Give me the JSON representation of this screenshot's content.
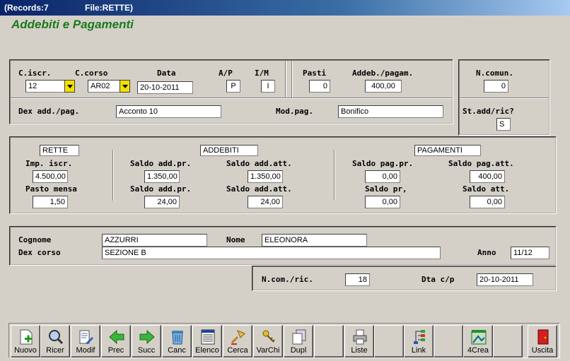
{
  "titlebar": {
    "records": "(Records:7",
    "file": "File:RETTE)"
  },
  "form_title": "Addebiti e Pagamenti",
  "top": {
    "labels": {
      "c_iscr": "C.iscr.",
      "c_corso": "C.corso",
      "data": "Data",
      "ap": "A/P",
      "im": "I/M",
      "pasti": "Pasti",
      "addeb": "Addeb./pagam.",
      "n_comun": "N.comun.",
      "dex": "Dex add./pag.",
      "mod_pag": "Mod.pag.",
      "st_add": "St.add/ric?"
    },
    "values": {
      "c_iscr": "12",
      "c_corso": "AR02",
      "data": "20-10-2011",
      "ap": "P",
      "im": "I",
      "pasti": "0",
      "addeb": "400,00",
      "n_comun": "0",
      "dex": "Acconto 10",
      "mod_pag": "Bonifico",
      "st_add": "S"
    }
  },
  "middle": {
    "rette": {
      "header": "RETTE",
      "imp_label": "Imp. iscr.",
      "imp_value": "4.500,00",
      "pasto_label": "Pasto mensa",
      "pasto_value": "1,50"
    },
    "addebiti": {
      "header": "ADDEBITI",
      "l1": "Saldo add.pr.",
      "v1": "1.350,00",
      "l2": "Saldo add.att.",
      "v2": "1.350,00",
      "l3": "Saldo add.pr.",
      "v3": "24,00",
      "l4": "Saldo add.att.",
      "v4": "24,00"
    },
    "pagamenti": {
      "header": "PAGAMENTI",
      "l1": "Saldo pag.pr.",
      "v1": "0,00",
      "l2": "Saldo pag.att.",
      "v2": "400,00",
      "l3": "Saldo pr,",
      "v3": "0,00",
      "l4": "Saldo att.",
      "v4": "0,00"
    }
  },
  "student": {
    "cognome_label": "Cognome",
    "cognome": "AZZURRI",
    "nome_label": "Nome",
    "nome": "ELEONORA",
    "dex_label": "Dex corso",
    "dex": "SEZIONE B",
    "anno_label": "Anno",
    "anno": "11/12"
  },
  "bottom": {
    "ncom_label": "N.com./ric.",
    "ncom": "18",
    "dta_label": "Dta c/p",
    "dta": "20-10-2011"
  },
  "toolbar": [
    {
      "label": "Nuovo",
      "icon": "new-doc-icon"
    },
    {
      "label": "Ricer",
      "icon": "magnifier-icon"
    },
    {
      "label": "Modif",
      "icon": "edit-doc-icon"
    },
    {
      "label": "Prec",
      "icon": "arrow-left-icon"
    },
    {
      "label": "Succ",
      "icon": "arrow-right-icon"
    },
    {
      "label": "Canc",
      "icon": "trash-icon"
    },
    {
      "label": "Elenco",
      "icon": "list-icon"
    },
    {
      "label": "Cerca",
      "icon": "search-icon"
    },
    {
      "label": "VarChi",
      "icon": "keys-icon"
    },
    {
      "label": "Dupl",
      "icon": "duplicate-icon"
    },
    {
      "label": "Liste",
      "icon": "printer-icon"
    },
    {
      "label": "Link",
      "icon": "link-icon"
    },
    {
      "label": "4Crea",
      "icon": "create-icon"
    },
    {
      "label": "Uscita",
      "icon": "exit-door-icon"
    }
  ]
}
